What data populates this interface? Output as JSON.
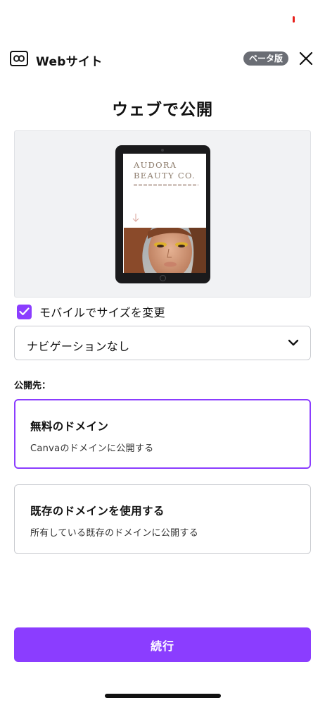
{
  "header": {
    "icon": "web-icon",
    "title": "Webサイト",
    "beta_badge": "ベータ版",
    "close_icon": "close-icon"
  },
  "page_title": "ウェブで公開",
  "preview": {
    "brand_line_1": "AUDORA",
    "brand_line_2": "BEAUTY CO."
  },
  "mobile_resize": {
    "label": "モバイルでサイズを変更",
    "checked": true
  },
  "navigation_select": {
    "value": "ナビゲーションなし"
  },
  "publish_section": {
    "label": "公開先：",
    "options": [
      {
        "title": "無料のドメイン",
        "description": "Canvaのドメインに公開する",
        "selected": true
      },
      {
        "title": "既存のドメインを使用する",
        "description": "所有している既存のドメインに公開する",
        "selected": false
      }
    ]
  },
  "continue_button": "続行",
  "colors": {
    "accent": "#8b3dff",
    "badge": "#6a6d74",
    "status_dot": "#e8201c"
  }
}
